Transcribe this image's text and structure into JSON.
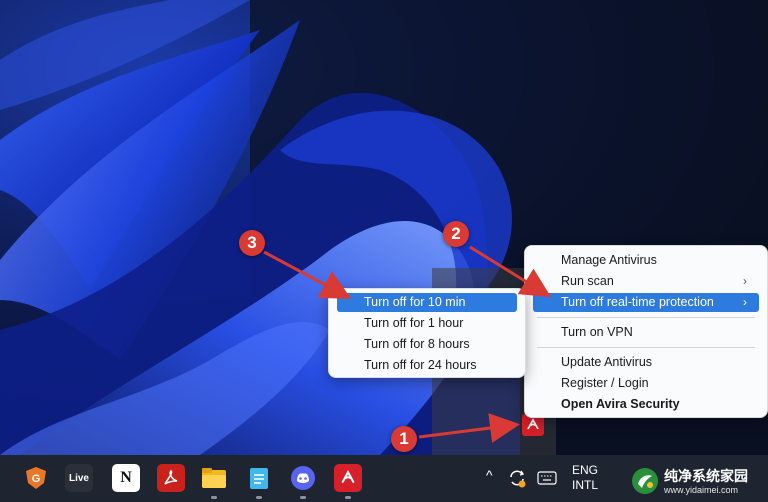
{
  "context_menu": {
    "items": [
      {
        "label": "Manage Antivirus"
      },
      {
        "label": "Run scan",
        "chevron": "›"
      },
      {
        "label": "Turn off real-time protection",
        "chevron": "›",
        "highlighted": true
      },
      {
        "label": "Turn on VPN"
      },
      {
        "label": "Update Antivirus"
      },
      {
        "label": "Register / Login"
      },
      {
        "label": "Open Avira Security",
        "bold": true
      }
    ]
  },
  "submenu": {
    "items": [
      {
        "label": "Turn off for 10 min",
        "highlighted": true
      },
      {
        "label": "Turn off for 1 hour"
      },
      {
        "label": "Turn off for 8 hours"
      },
      {
        "label": "Turn off for 24 hours"
      }
    ]
  },
  "annotations": {
    "step1": "1",
    "step2": "2",
    "step3": "3"
  },
  "taskbar": {
    "live_label": "Live",
    "notion_label": "N",
    "tray_chevron": "^",
    "language_line1": "ENG",
    "language_line2": "INTL"
  },
  "watermark": {
    "title": "纯净系统家园",
    "url": "www.yidaimei.com"
  },
  "colors": {
    "highlight": "#2e7be0",
    "annotation": "#d93a33",
    "avira": "#d8202a",
    "taskbar": "#1e2430"
  }
}
